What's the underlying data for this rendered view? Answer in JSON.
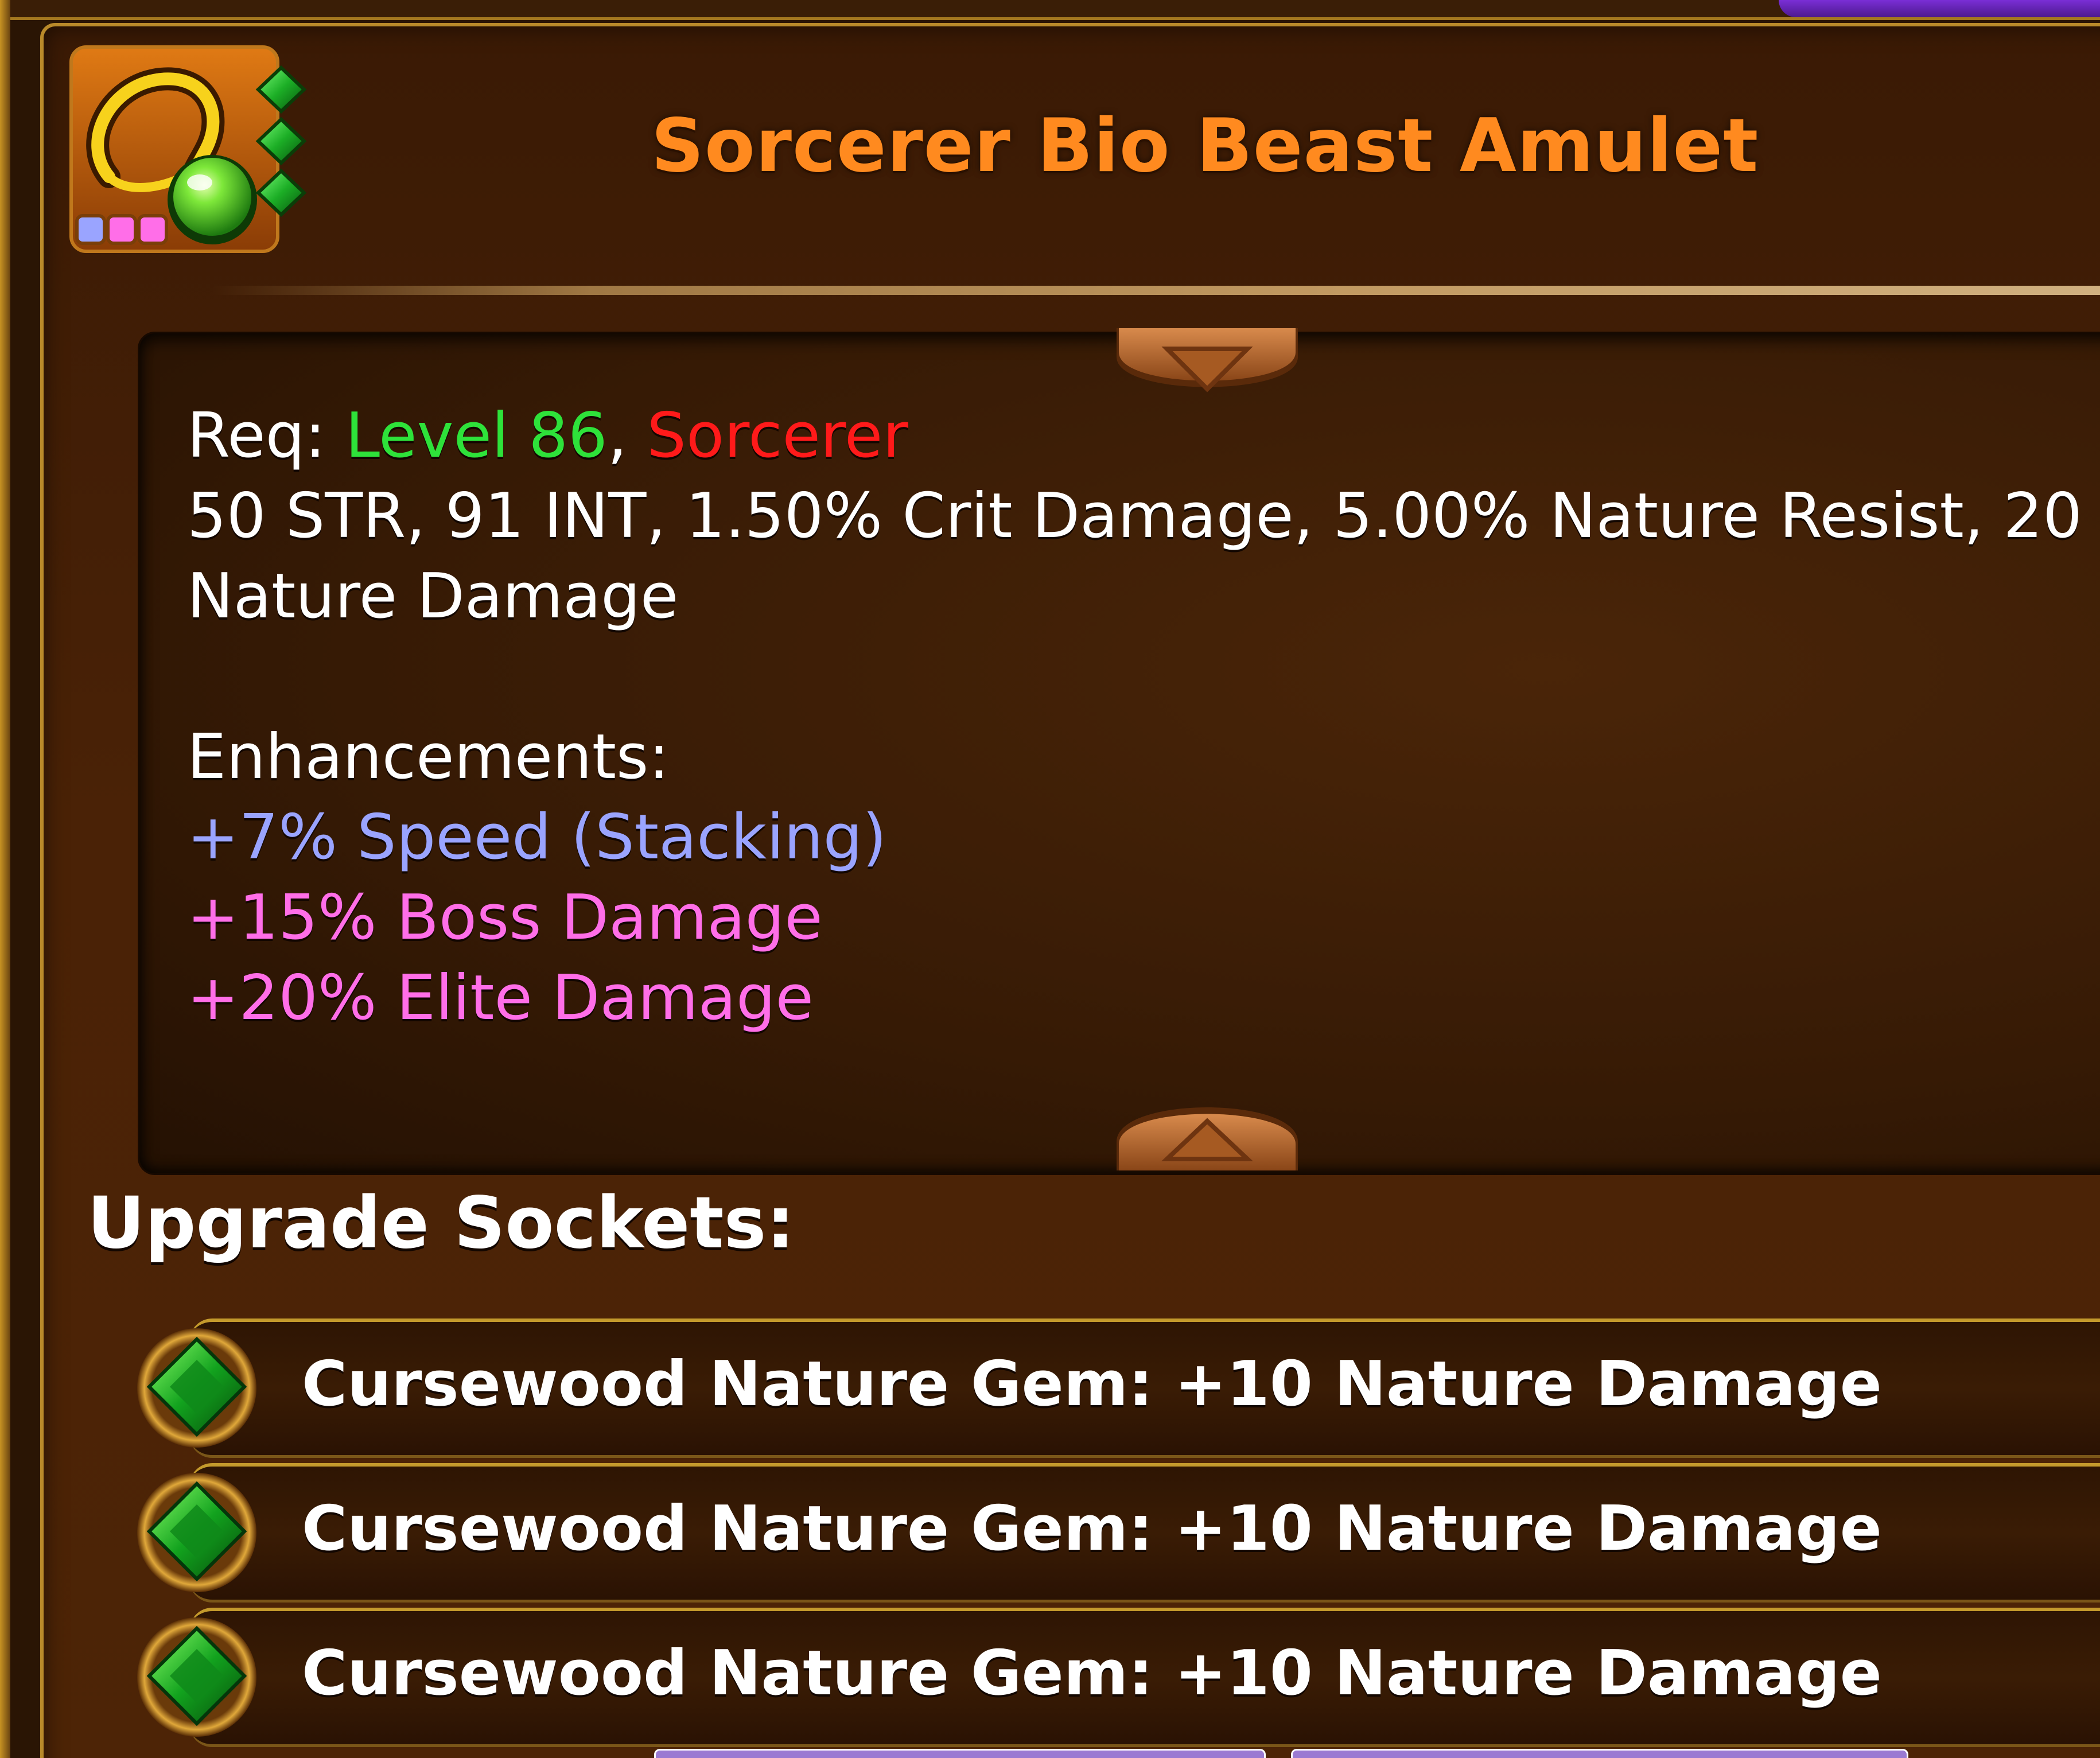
{
  "item": {
    "title": "Sorcerer Bio Beast Amulet",
    "icon": "amulet-icon",
    "enhancement_slot_colors": [
      "#9aa4ff",
      "#ff6ee8",
      "#ff6ee8"
    ],
    "socket_gem_color": "#1fb52a"
  },
  "requirements": {
    "prefix": "Req: ",
    "level": "Level 86",
    "separator": ", ",
    "class": "Sorcerer"
  },
  "stats": {
    "line1": "50 STR, 91 INT, 1.50% Crit Damage, 5.00% Nature Resist, 20",
    "line2": "Nature Damage"
  },
  "enhancements": {
    "heading": "Enhancements:",
    "items": [
      {
        "text": "+7% Speed (Stacking)",
        "color": "#9aa4ff"
      },
      {
        "text": "+15% Boss Damage",
        "color": "#ff6ee8"
      },
      {
        "text": "+20% Elite Damage",
        "color": "#ff6ee8"
      }
    ]
  },
  "sockets": {
    "heading": "Upgrade Sockets:",
    "items": [
      {
        "text": "Cursewood Nature Gem: +10 Nature Damage",
        "icon": "green-gem-icon"
      },
      {
        "text": "Cursewood Nature Gem: +10 Nature Damage",
        "icon": "green-gem-icon"
      },
      {
        "text": "Cursewood Nature Gem: +10 Nature Damage",
        "icon": "green-gem-icon"
      }
    ]
  },
  "colors": {
    "title": "#ff8a1f",
    "level": "#2ee23a",
    "class": "#ff1a1a",
    "border_gold": "#b98a2a"
  }
}
